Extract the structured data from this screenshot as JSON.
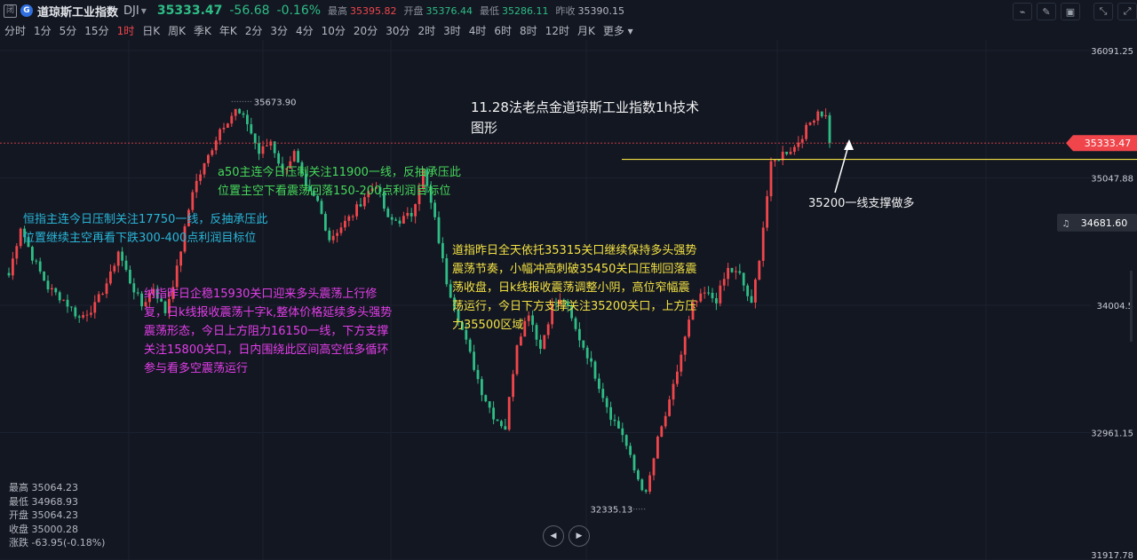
{
  "header": {
    "badge": "闭",
    "logo": "G",
    "name": "道琼斯工业指数",
    "code": "DJI",
    "price": "35333.47",
    "change": "-56.68",
    "change_pct": "-0.16%",
    "stats": [
      {
        "label": "最高",
        "value": "35395.82",
        "tone": "red"
      },
      {
        "label": "开盘",
        "value": "35376.44",
        "tone": "green"
      },
      {
        "label": "最低",
        "value": "35286.11",
        "tone": "green"
      },
      {
        "label": "昨收",
        "value": "35390.15",
        "tone": "grey"
      }
    ],
    "icons": [
      "indicator-icon",
      "draw-icon",
      "delete-icon",
      "collapse-icon",
      "expand-icon"
    ]
  },
  "intervals": [
    "分时",
    "1分",
    "5分",
    "15分",
    "1时",
    "日K",
    "周K",
    "季K",
    "年K",
    "2分",
    "3分",
    "4分",
    "10分",
    "20分",
    "30分",
    "2时",
    "3时",
    "4时",
    "6时",
    "8时",
    "12时",
    "月K",
    "更多"
  ],
  "active_interval": "1时",
  "annotations": {
    "title": [
      "11.28法老点金道琼斯工业指数1h技术",
      "图形"
    ],
    "cyan": [
      "恒指主连今日压制关注17750一线，反抽承压此",
      "位置继续主空再看下跌300-400点利润目标位"
    ],
    "green": [
      "a50主连今日压制关注11900一线，反抽承压此",
      "位置主空下看震荡回落150-200点利润目标位"
    ],
    "magenta": [
      "纳指昨日企稳15930关口迎来多头震荡上行修",
      "复，日k线报收震荡十字k,整体价格延续多头强势",
      "震荡形态，今日上方阻力16150一线，下方支撑",
      "关注15800关口，日内围绕此区间高空低多循环",
      "参与看多空震荡运行"
    ],
    "yellow": [
      "道指昨日全天依托35315关口继续保持多头强势",
      "震荡节奏，小幅冲高刺破35450关口压制回落震",
      "荡收盘，日k线报收震荡调整小阴，高位窄幅震",
      "荡运行，今日下方支撑关注35200关口，上方压",
      "力35500区域"
    ],
    "support": "35200一线支撑做多"
  },
  "ohlc": [
    {
      "label": "最高",
      "value": "35064.23"
    },
    {
      "label": "最低",
      "value": "34968.93"
    },
    {
      "label": "开盘",
      "value": "35064.23"
    },
    {
      "label": "收盘",
      "value": "35000.28"
    },
    {
      "label": "涨跌",
      "value": "-63.95(-0.18%)"
    }
  ],
  "nav": {
    "prev": "◀",
    "next": "▶"
  },
  "colors": {
    "up": "#f0464b",
    "down": "#2ebd85",
    "background": "#131722",
    "support_line": "#f3e243",
    "price_line": "#f0464b"
  },
  "chart_data": {
    "type": "candlestick",
    "interval": "1h",
    "y_ticks": [
      "36091.25",
      "35047.88",
      "34004.5",
      "32961.15",
      "31917.78"
    ],
    "ylim": [
      31917.78,
      36091.25
    ],
    "current_price": {
      "value": 35333.47,
      "label": "35333.47"
    },
    "crosshair_price": {
      "value": 34681.6,
      "label": "34681.60"
    },
    "support_line": 35200,
    "high_marker": {
      "value": 35673.9,
      "label": "35673.90"
    },
    "low_marker": {
      "value": 32335.13,
      "label": "32335.13"
    },
    "path_anchors": [
      [
        0,
        34250
      ],
      [
        3,
        34650
      ],
      [
        6,
        34400
      ],
      [
        10,
        34150
      ],
      [
        14,
        34050
      ],
      [
        18,
        33900
      ],
      [
        22,
        34000
      ],
      [
        26,
        34250
      ],
      [
        28,
        34450
      ],
      [
        31,
        34200
      ],
      [
        34,
        34000
      ],
      [
        37,
        34150
      ],
      [
        40,
        33950
      ],
      [
        43,
        34300
      ],
      [
        47,
        34950
      ],
      [
        50,
        35150
      ],
      [
        54,
        35450
      ],
      [
        58,
        35600
      ],
      [
        61,
        35500
      ],
      [
        64,
        35250
      ],
      [
        67,
        35350
      ],
      [
        70,
        35100
      ],
      [
        73,
        35250
      ],
      [
        76,
        34950
      ],
      [
        79,
        34850
      ],
      [
        82,
        34550
      ],
      [
        85,
        34650
      ],
      [
        88,
        34750
      ],
      [
        91,
        34900
      ],
      [
        94,
        35000
      ],
      [
        97,
        34700
      ],
      [
        100,
        34700
      ],
      [
        103,
        34750
      ],
      [
        106,
        35100
      ],
      [
        109,
        34700
      ],
      [
        112,
        34200
      ],
      [
        115,
        33900
      ],
      [
        118,
        33600
      ],
      [
        121,
        33300
      ],
      [
        124,
        33100
      ],
      [
        127,
        33000
      ],
      [
        130,
        33700
      ],
      [
        133,
        33950
      ],
      [
        136,
        33650
      ],
      [
        139,
        34000
      ],
      [
        142,
        34050
      ],
      [
        145,
        33800
      ],
      [
        148,
        33600
      ],
      [
        151,
        33350
      ],
      [
        154,
        33100
      ],
      [
        157,
        32950
      ],
      [
        160,
        32650
      ],
      [
        163,
        32450
      ],
      [
        166,
        32900
      ],
      [
        169,
        33200
      ],
      [
        172,
        33600
      ],
      [
        175,
        34000
      ],
      [
        178,
        34100
      ],
      [
        181,
        34050
      ],
      [
        184,
        34300
      ],
      [
        187,
        34250
      ],
      [
        190,
        34000
      ],
      [
        192,
        34400
      ],
      [
        195,
        35150
      ],
      [
        198,
        35250
      ],
      [
        201,
        35300
      ],
      [
        204,
        35450
      ],
      [
        207,
        35600
      ],
      [
        209,
        35550
      ],
      [
        210,
        35333
      ]
    ]
  }
}
